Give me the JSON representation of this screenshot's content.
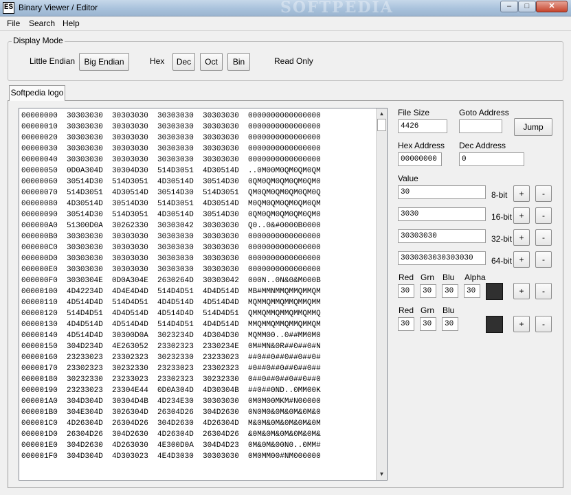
{
  "window": {
    "title": "Binary Viewer / Editor",
    "icon_text": "ES",
    "watermark": "SOFTPEDIA"
  },
  "menu": [
    "File",
    "Search",
    "Help"
  ],
  "display_mode": {
    "legend": "Display Mode",
    "little_endian": "Little Endian",
    "big_endian": "Big Endian",
    "hex": "Hex",
    "dec": "Dec",
    "oct": "Oct",
    "bin": "Bin",
    "read_only": "Read Only"
  },
  "tab": {
    "label": "Softpedia logo"
  },
  "hex_lines": [
    "00000000  30303030  30303030  30303030  30303030  0000000000000000",
    "00000010  30303030  30303030  30303030  30303030  0000000000000000",
    "00000020  30303030  30303030  30303030  30303030  0000000000000000",
    "00000030  30303030  30303030  30303030  30303030  0000000000000000",
    "00000040  30303030  30303030  30303030  30303030  0000000000000000",
    "00000050  0D0A304D  30304D30  514D3051  4D30514D  ..0M00M0QM0QM0QM",
    "00000060  30514D30  514D3051  4D30514D  30514D30  0QM0QM0QM0QM0QM0",
    "00000070  514D3051  4D30514D  30514D30  514D3051  QM0QM0QM0QM0QM0Q",
    "00000080  4D30514D  30514D30  514D3051  4D30514D  M0QM0QM0QM0QM0QM",
    "00000090  30514D30  514D3051  4D30514D  30514D30  0QM0QM0QM0QM0QM0",
    "000000A0  51300D0A  30262330  30303042  30303030  Q0..0&#0000B0000",
    "000000B0  30303030  30303030  30303030  30303030  0000000000000000",
    "000000C0  30303030  30303030  30303030  30303030  0000000000000000",
    "000000D0  30303030  30303030  30303030  30303030  0000000000000000",
    "000000E0  30303030  30303030  30303030  30303030  0000000000000000",
    "000000F0  3030304E  0D0A304E  2630264D  30303042  000N..0N&0&M000B",
    "00000100  4D42234D  4D4E4D4D  514D4D51  4D4D514D  MB#MMNMMQMMQMMQM",
    "00000110  4D514D4D  514D4D51  4D4D514D  4D514D4D  MQMMQMMQMMQMMQMM",
    "00000120  514D4D51  4D4D514D  4D514D4D  514D4D51  QMMQMMQMMQMMQMMQ",
    "00000130  4D4D514D  4D514D4D  514D4D51  4D4D514D  MMQMMQMMQMMQMMQM",
    "00000140  4D514D4D  30300D0A  3023234D  4D304D30  MQMM00..0##MM0M0",
    "00000150  304D234D  4E263052  23302323  2330234E  0M#MN&0R##0##0#N",
    "00000160  23233023  23302323  30232330  23233023  ##0##0##0##0##0#",
    "00000170  23302323  30232330  23233023  23302323  #0##0##0##0##0##",
    "00000180  30232330  23233023  23302323  30232330  0##0##0##0##0##0",
    "00000190  23233023  23304E44  0D0A304D  4D30304B  ##0##0ND..0MM00K",
    "000001A0  304D304D  30304D4B  4D234E30  30303030  0M0M00MKM#N00000",
    "000001B0  304E304D  3026304D  26304D26  304D2630  0N0M0&0M&0M&0M&0",
    "000001C0  4D26304D  26304D26  304D2630  4D26304D  M&0M&0M&0M&0M&0M",
    "000001D0  26304D26  304D2630  4D26304D  26304D26  &0M&0M&0M&0M&0M&",
    "000001E0  304D2630  4D263030  4E300D0A  304D4D23  0M&0M&00N0..0MM#",
    "000001F0  304D304D  4D303023  4E4D3030  30303030  0M0MM00#NM000000"
  ],
  "panel": {
    "file_size_label": "File Size",
    "file_size": "4426",
    "goto_address_label": "Goto Address",
    "goto_address": "",
    "jump": "Jump",
    "hex_address_label": "Hex Address",
    "hex_address": "00000000",
    "dec_address_label": "Dec Address",
    "dec_address": "0",
    "value_label": "Value",
    "values": [
      {
        "value": "30",
        "bits": "8-bit"
      },
      {
        "value": "3030",
        "bits": "16-bit"
      },
      {
        "value": "30303030",
        "bits": "32-bit"
      },
      {
        "value": "3030303030303030",
        "bits": "64-bit"
      }
    ],
    "plus": "+",
    "minus": "-",
    "color1": {
      "red_label": "Red",
      "grn_label": "Grn",
      "blu_label": "Blu",
      "alpha_label": "Alpha",
      "red": "30",
      "grn": "30",
      "blu": "30",
      "alpha": "30",
      "swatch": "#303030"
    },
    "color2": {
      "red_label": "Red",
      "grn_label": "Grn",
      "blu_label": "Blu",
      "red": "30",
      "grn": "30",
      "blu": "30",
      "swatch": "#303030"
    }
  },
  "icons": {
    "min": "minimize-icon",
    "max": "maximize-icon",
    "close": "close-icon",
    "up": "scroll-up-icon",
    "down": "scroll-down-icon"
  }
}
